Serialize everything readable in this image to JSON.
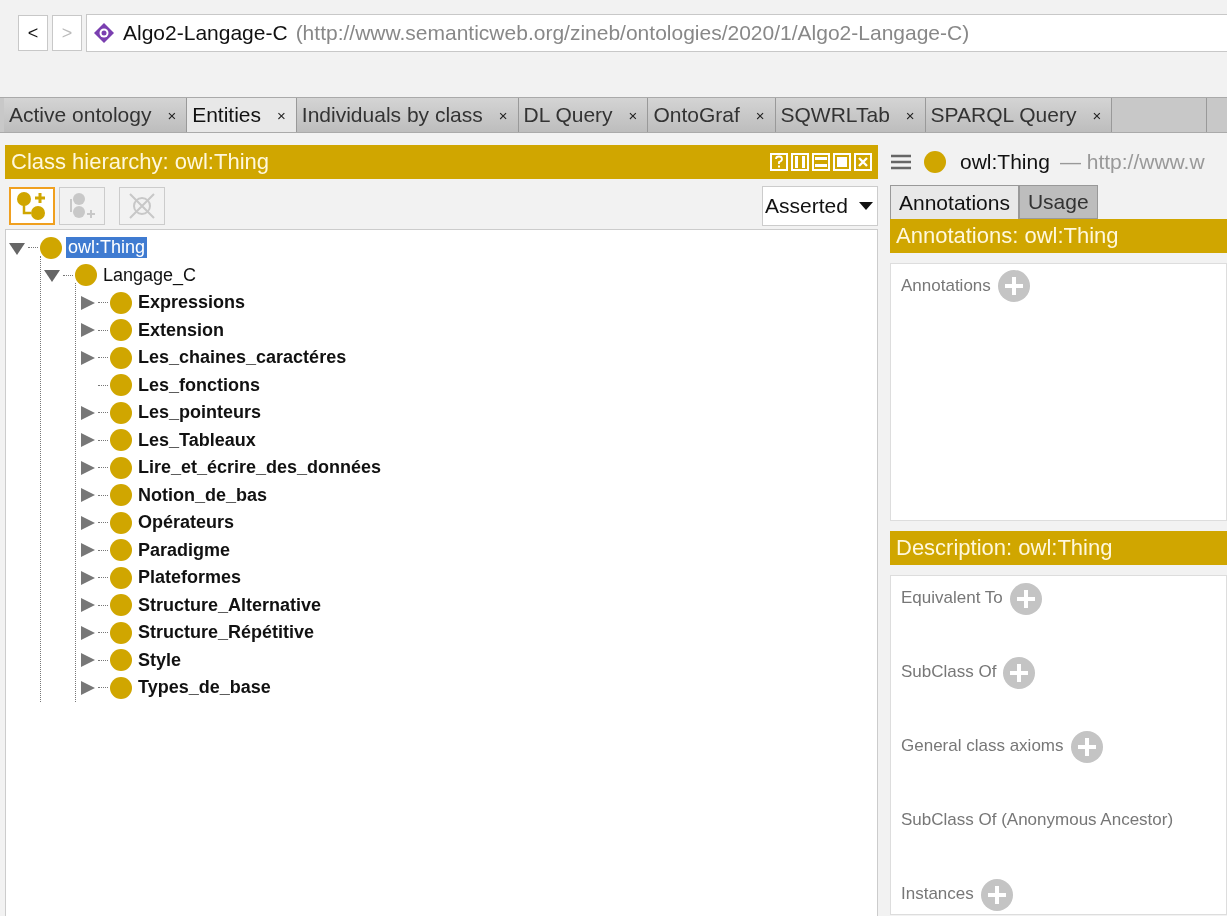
{
  "navigation": {
    "back": {
      "label": "<",
      "disabled": false
    },
    "forward": {
      "label": ">",
      "disabled": true
    }
  },
  "address": {
    "name": "Algo2-Langage-C",
    "iri": "(http://www.semanticweb.org/zineb/ontologies/2020/1/Algo2-Langage-C)"
  },
  "tabs": [
    {
      "label": "Active ontology",
      "close": "×",
      "selected": false
    },
    {
      "label": "Entities",
      "close": "×",
      "selected": true
    },
    {
      "label": "Individuals by class",
      "close": "×",
      "selected": false
    },
    {
      "label": "DL Query",
      "close": "×",
      "selected": false
    },
    {
      "label": "OntoGraf",
      "close": "×",
      "selected": false
    },
    {
      "label": "SQWRLTab",
      "close": "×",
      "selected": false
    },
    {
      "label": "SPARQL Query",
      "close": "×",
      "selected": false
    }
  ],
  "class_hierarchy": {
    "title": "Class hierarchy: owl:Thing",
    "view_buttons": [
      {
        "kind": "help"
      },
      {
        "kind": "split-vertical"
      },
      {
        "kind": "split-horizontal"
      },
      {
        "kind": "maximize"
      },
      {
        "kind": "close"
      }
    ],
    "tools": [
      {
        "kind": "add-subclass",
        "selected": true,
        "disabled": false
      },
      {
        "kind": "add-sibling",
        "selected": false,
        "disabled": true
      },
      {
        "kind": "delete",
        "selected": false,
        "disabled": true
      }
    ],
    "mode": "Asserted",
    "tree": [
      {
        "label": "owl:Thing",
        "selected": true,
        "bold": false,
        "expanded": true,
        "children": [
          {
            "label": "Langage_C",
            "selected": false,
            "bold": false,
            "expanded": true,
            "children": [
              {
                "label": "Expressions",
                "selected": false,
                "bold": true,
                "expanded": false,
                "has_children": true
              },
              {
                "label": "Extension",
                "selected": false,
                "bold": true,
                "expanded": false,
                "has_children": true
              },
              {
                "label": "Les_chaines_caractéres",
                "selected": false,
                "bold": true,
                "expanded": false,
                "has_children": true
              },
              {
                "label": "Les_fonctions",
                "selected": false,
                "bold": true,
                "has_children": false
              },
              {
                "label": "Les_pointeurs",
                "selected": false,
                "bold": true,
                "expanded": false,
                "has_children": true
              },
              {
                "label": "Les_Tableaux",
                "selected": false,
                "bold": true,
                "expanded": false,
                "has_children": true
              },
              {
                "label": "Lire_et_écrire_des_données",
                "selected": false,
                "bold": true,
                "expanded": false,
                "has_children": true
              },
              {
                "label": "Notion_de_bas",
                "selected": false,
                "bold": true,
                "expanded": false,
                "has_children": true
              },
              {
                "label": "Opérateurs",
                "selected": false,
                "bold": true,
                "expanded": false,
                "has_children": true
              },
              {
                "label": "Paradigme",
                "selected": false,
                "bold": true,
                "expanded": false,
                "has_children": true
              },
              {
                "label": "Plateformes",
                "selected": false,
                "bold": true,
                "expanded": false,
                "has_children": true
              },
              {
                "label": "Structure_Alternative",
                "selected": false,
                "bold": true,
                "expanded": false,
                "has_children": true
              },
              {
                "label": "Structure_Répétitive",
                "selected": false,
                "bold": true,
                "expanded": false,
                "has_children": true
              },
              {
                "label": "Style",
                "selected": false,
                "bold": true,
                "expanded": false,
                "has_children": true
              },
              {
                "label": "Types_de_base",
                "selected": false,
                "bold": true,
                "expanded": false,
                "has_children": true
              }
            ]
          }
        ]
      }
    ]
  },
  "entity": {
    "name": "owl:Thing",
    "iri": "— http://www.w",
    "tabs": [
      {
        "label": "Annotations",
        "selected": true
      },
      {
        "label": "Usage",
        "selected": false
      }
    ],
    "annotations": {
      "title": "Annotations: owl:Thing",
      "sections": [
        {
          "label": "Annotations",
          "add_button": true
        }
      ]
    },
    "description": {
      "title": "Description: owl:Thing",
      "sections": [
        {
          "label": "Equivalent To",
          "add_button": true
        },
        {
          "label": "SubClass Of",
          "add_button": true
        },
        {
          "label": "General class axioms",
          "add_button": true
        },
        {
          "label": "SubClass Of (Anonymous Ancestor)",
          "add_button": false
        },
        {
          "label": "Instances",
          "add_button": true
        }
      ]
    }
  }
}
